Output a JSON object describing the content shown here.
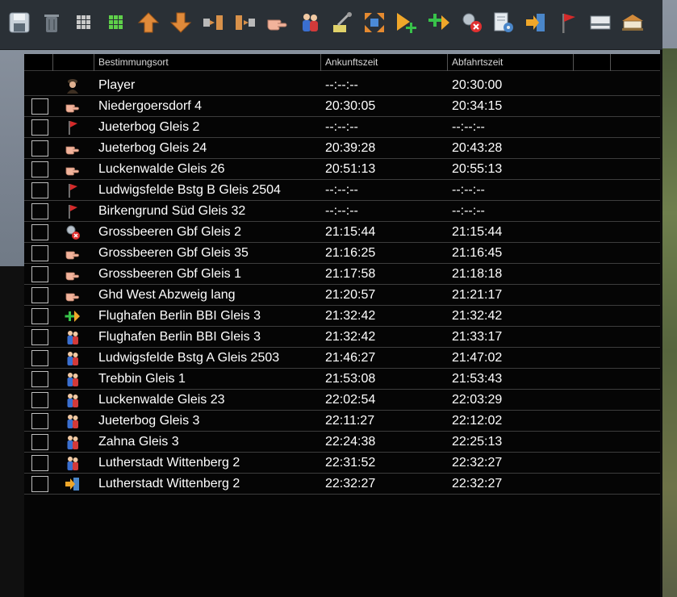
{
  "columns": {
    "destination": "Bestimmungsort",
    "arrival": "Ankunftszeit",
    "departure": "Abfahrtszeit"
  },
  "toolbar": [
    {
      "name": "save-icon"
    },
    {
      "name": "trash-icon"
    },
    {
      "name": "grid-dark-icon"
    },
    {
      "name": "grid-green-icon"
    },
    {
      "name": "arrow-up-icon"
    },
    {
      "name": "arrow-down-icon"
    },
    {
      "name": "couple-icon"
    },
    {
      "name": "uncouple-icon"
    },
    {
      "name": "pointing-hand-icon"
    },
    {
      "name": "passengers-icon"
    },
    {
      "name": "wrench-icon"
    },
    {
      "name": "expand-icon"
    },
    {
      "name": "play-add-icon"
    },
    {
      "name": "arrow-add-icon"
    },
    {
      "name": "remove-icon"
    },
    {
      "name": "settings-doc-icon"
    },
    {
      "name": "enter-icon"
    },
    {
      "name": "red-flag-icon"
    },
    {
      "name": "panel-icon"
    },
    {
      "name": "station-icon"
    }
  ],
  "rows": [
    {
      "icon": "player",
      "dest": "Player",
      "arr": "--:--:--",
      "dep": "20:30:00",
      "checkbox": false
    },
    {
      "icon": "hand",
      "dest": "Niedergoersdorf 4",
      "arr": "20:30:05",
      "dep": "20:34:15",
      "checkbox": true
    },
    {
      "icon": "flag",
      "dest": "Jueterbog Gleis 2",
      "arr": "--:--:--",
      "dep": "--:--:--",
      "checkbox": true
    },
    {
      "icon": "hand",
      "dest": "Jueterbog Gleis 24",
      "arr": "20:39:28",
      "dep": "20:43:28",
      "checkbox": true
    },
    {
      "icon": "hand",
      "dest": "Luckenwalde Gleis 26",
      "arr": "20:51:13",
      "dep": "20:55:13",
      "checkbox": true
    },
    {
      "icon": "flag",
      "dest": "Ludwigsfelde Bstg B Gleis 2504",
      "arr": "--:--:--",
      "dep": "--:--:--",
      "checkbox": true
    },
    {
      "icon": "flag",
      "dest": "Birkengrund Süd Gleis 32",
      "arr": "--:--:--",
      "dep": "--:--:--",
      "checkbox": true
    },
    {
      "icon": "remove",
      "dest": "Grossbeeren Gbf Gleis 2",
      "arr": "21:15:44",
      "dep": "21:15:44",
      "checkbox": true
    },
    {
      "icon": "hand",
      "dest": "Grossbeeren Gbf Gleis 35",
      "arr": "21:16:25",
      "dep": "21:16:45",
      "checkbox": true
    },
    {
      "icon": "hand",
      "dest": "Grossbeeren Gbf Gleis 1",
      "arr": "21:17:58",
      "dep": "21:18:18",
      "checkbox": true
    },
    {
      "icon": "hand",
      "dest": "Ghd West Abzweig lang",
      "arr": "21:20:57",
      "dep": "21:21:17",
      "checkbox": true
    },
    {
      "icon": "addarrow",
      "dest": "Flughafen Berlin BBI Gleis 3",
      "arr": "21:32:42",
      "dep": "21:32:42",
      "checkbox": true
    },
    {
      "icon": "people",
      "dest": "Flughafen Berlin BBI Gleis 3",
      "arr": "21:32:42",
      "dep": "21:33:17",
      "checkbox": true
    },
    {
      "icon": "people",
      "dest": "Ludwigsfelde Bstg A Gleis 2503",
      "arr": "21:46:27",
      "dep": "21:47:02",
      "checkbox": true
    },
    {
      "icon": "people",
      "dest": "Trebbin Gleis 1",
      "arr": "21:53:08",
      "dep": "21:53:43",
      "checkbox": true
    },
    {
      "icon": "people",
      "dest": "Luckenwalde Gleis 23",
      "arr": "22:02:54",
      "dep": "22:03:29",
      "checkbox": true
    },
    {
      "icon": "people",
      "dest": "Jueterbog Gleis 3",
      "arr": "22:11:27",
      "dep": "22:12:02",
      "checkbox": true
    },
    {
      "icon": "people",
      "dest": "Zahna Gleis 3",
      "arr": "22:24:38",
      "dep": "22:25:13",
      "checkbox": true
    },
    {
      "icon": "people",
      "dest": "Lutherstadt Wittenberg 2",
      "arr": "22:31:52",
      "dep": "22:32:27",
      "checkbox": true
    },
    {
      "icon": "enter",
      "dest": "Lutherstadt Wittenberg 2",
      "arr": "22:32:27",
      "dep": "22:32:27",
      "checkbox": true
    }
  ]
}
